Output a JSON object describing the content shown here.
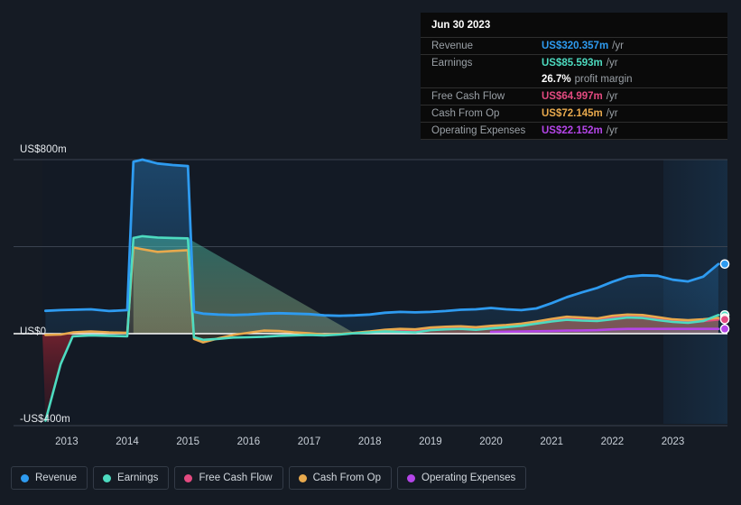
{
  "tooltip": {
    "date": "Jun 30 2023",
    "rows": [
      {
        "label": "Revenue",
        "value": "US$320.357m",
        "unit": "/yr",
        "color": "#2e9bf0"
      },
      {
        "label": "Earnings",
        "value": "US$85.593m",
        "unit": "/yr",
        "color": "#4ddbc0"
      },
      {
        "label": "Free Cash Flow",
        "value": "US$64.997m",
        "unit": "/yr",
        "color": "#e34a80"
      },
      {
        "label": "Cash From Op",
        "value": "US$72.145m",
        "unit": "/yr",
        "color": "#e8a94d"
      },
      {
        "label": "Operating Expenses",
        "value": "US$22.152m",
        "unit": "/yr",
        "color": "#b445e8"
      }
    ],
    "margin_value": "26.7%",
    "margin_text": "profit margin"
  },
  "legend": [
    {
      "label": "Revenue",
      "color": "#2e9bf0"
    },
    {
      "label": "Earnings",
      "color": "#4ddbc0"
    },
    {
      "label": "Free Cash Flow",
      "color": "#e34a80"
    },
    {
      "label": "Cash From Op",
      "color": "#e8a94d"
    },
    {
      "label": "Operating Expenses",
      "color": "#b445e8"
    }
  ],
  "axis": {
    "y_top": "US$800m",
    "y_zero": "US$0",
    "y_bottom": "-US$400m",
    "x_ticks": [
      "2013",
      "2014",
      "2015",
      "2016",
      "2017",
      "2018",
      "2019",
      "2020",
      "2021",
      "2022",
      "2023"
    ]
  },
  "chart_data": {
    "type": "area",
    "title": "",
    "xlabel": "",
    "ylabel": "US$",
    "ylim": [
      -400,
      800
    ],
    "xlim": [
      2012.6,
      2023.9
    ],
    "grid": true,
    "legend_position": "bottom",
    "zero_line": 0,
    "forecast_start": 2022.95,
    "x": [
      2012.65,
      2012.9,
      2013.1,
      2013.4,
      2013.7,
      2014.0,
      2014.1,
      2014.25,
      2014.5,
      2014.75,
      2015.0,
      2015.1,
      2015.25,
      2015.5,
      2015.75,
      2016.0,
      2016.25,
      2016.5,
      2016.75,
      2017.0,
      2017.25,
      2017.5,
      2017.75,
      2018.0,
      2018.25,
      2018.5,
      2018.75,
      2019.0,
      2019.25,
      2019.5,
      2019.75,
      2020.0,
      2020.25,
      2020.5,
      2020.75,
      2021.0,
      2021.25,
      2021.5,
      2021.75,
      2022.0,
      2022.25,
      2022.5,
      2022.75,
      2023.0,
      2023.25,
      2023.5,
      2023.75
    ],
    "series": [
      {
        "name": "Revenue",
        "color": "#2e9bf0",
        "values": [
          105,
          108,
          110,
          112,
          104,
          108,
          790,
          800,
          782,
          775,
          770,
          100,
          92,
          88,
          86,
          88,
          92,
          94,
          92,
          90,
          84,
          82,
          84,
          88,
          96,
          100,
          98,
          100,
          104,
          110,
          112,
          118,
          112,
          108,
          116,
          140,
          168,
          190,
          210,
          238,
          262,
          268,
          266,
          248,
          240,
          262,
          320
        ]
      },
      {
        "name": "Earnings",
        "color": "#4ddbc0",
        "values": [
          -400,
          -140,
          -12,
          -8,
          -10,
          -12,
          440,
          448,
          442,
          440,
          438,
          -16,
          -28,
          -24,
          -18,
          -16,
          -14,
          -10,
          -8,
          -6,
          -8,
          -4,
          2,
          6,
          10,
          8,
          6,
          16,
          20,
          22,
          18,
          24,
          30,
          36,
          46,
          56,
          64,
          60,
          58,
          66,
          74,
          72,
          62,
          54,
          50,
          58,
          86
        ]
      },
      {
        "name": "Free Cash Flow",
        "color": "#e34a80",
        "values": [
          null,
          null,
          null,
          null,
          null,
          null,
          null,
          null,
          null,
          null,
          null,
          null,
          null,
          null,
          null,
          null,
          null,
          null,
          null,
          null,
          null,
          null,
          null,
          null,
          12,
          16,
          14,
          22,
          26,
          28,
          26,
          30,
          34,
          40,
          50,
          60,
          70,
          66,
          62,
          74,
          80,
          78,
          68,
          58,
          54,
          58,
          65
        ]
      },
      {
        "name": "Cash From Op",
        "color": "#e8a94d",
        "values": [
          -6,
          -4,
          6,
          10,
          6,
          4,
          396,
          388,
          376,
          380,
          384,
          -24,
          -40,
          -22,
          -6,
          4,
          14,
          12,
          6,
          2,
          -4,
          -2,
          4,
          10,
          18,
          22,
          20,
          28,
          32,
          34,
          30,
          36,
          40,
          46,
          56,
          68,
          78,
          74,
          70,
          82,
          88,
          86,
          76,
          66,
          62,
          66,
          72
        ]
      },
      {
        "name": "Operating Expenses",
        "color": "#b445e8",
        "values": [
          null,
          null,
          null,
          null,
          null,
          null,
          null,
          null,
          null,
          null,
          null,
          null,
          null,
          null,
          null,
          null,
          null,
          null,
          null,
          null,
          null,
          null,
          null,
          null,
          null,
          null,
          null,
          null,
          null,
          null,
          null,
          8,
          9,
          10,
          11,
          12,
          14,
          15,
          16,
          20,
          22,
          22,
          22,
          22,
          22,
          22,
          22
        ]
      }
    ]
  }
}
